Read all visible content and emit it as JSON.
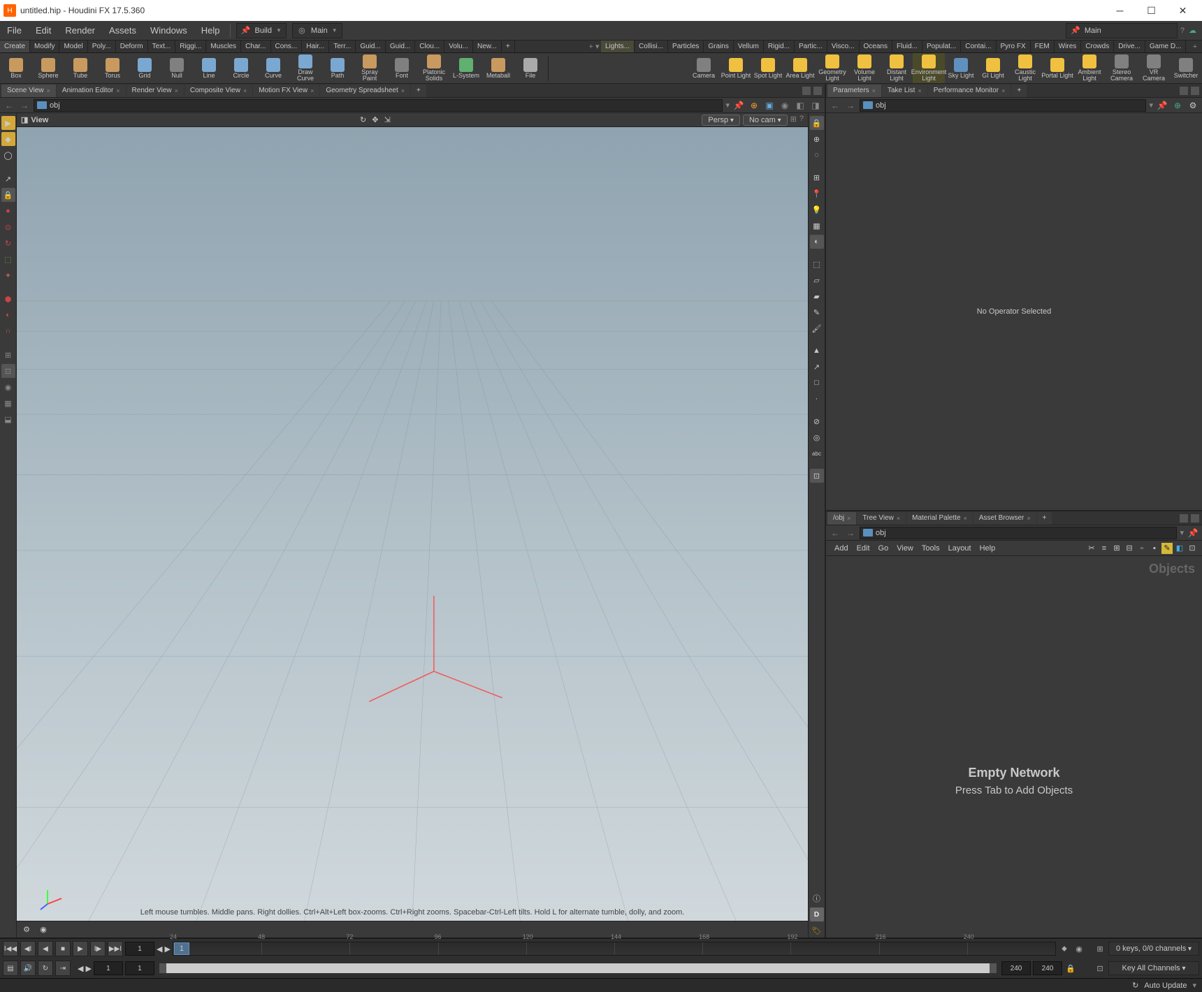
{
  "window": {
    "title": "untitled.hip - Houdini FX 17.5.360"
  },
  "menus": [
    "File",
    "Edit",
    "Render",
    "Assets",
    "Windows",
    "Help"
  ],
  "desktops": {
    "left": "Build",
    "right": "Main",
    "combo": "Main"
  },
  "shelf_tabs_left": [
    "Create",
    "Modify",
    "Model",
    "Poly...",
    "Deform",
    "Text...",
    "Riggi...",
    "Muscles",
    "Char...",
    "Cons...",
    "Hair...",
    "Terr...",
    "Guid...",
    "Guid...",
    "Clou...",
    "Volu...",
    "New...",
    "+"
  ],
  "shelf_tabs_right": [
    "Lights...",
    "Collisi...",
    "Particles",
    "Grains",
    "Vellum",
    "Rigid...",
    "Partic...",
    "Visco...",
    "Oceans",
    "Fluid...",
    "Populat...",
    "Contai...",
    "Pyro FX",
    "FEM",
    "Wires",
    "Crowds",
    "Drive...",
    "Game D...",
    "+"
  ],
  "create_tools": [
    {
      "label": "Box",
      "color": "#c89a60"
    },
    {
      "label": "Sphere",
      "color": "#c89a60"
    },
    {
      "label": "Tube",
      "color": "#c89a60"
    },
    {
      "label": "Torus",
      "color": "#c89a60"
    },
    {
      "label": "Grid",
      "color": "#7aa8d0"
    },
    {
      "label": "Null",
      "color": "#808080"
    },
    {
      "label": "Line",
      "color": "#7aa8d0"
    },
    {
      "label": "Circle",
      "color": "#7aa8d0"
    },
    {
      "label": "Curve",
      "color": "#7aa8d0"
    },
    {
      "label": "Draw Curve",
      "color": "#7aa8d0"
    },
    {
      "label": "Path",
      "color": "#7aa8d0"
    },
    {
      "label": "Spray Paint",
      "color": "#c89a60"
    },
    {
      "label": "Font",
      "color": "#808080"
    },
    {
      "label": "Platonic Solids",
      "color": "#c89a60"
    },
    {
      "label": "L-System",
      "color": "#60b070"
    },
    {
      "label": "Metaball",
      "color": "#c89a60"
    },
    {
      "label": "File",
      "color": "#aaaaaa"
    }
  ],
  "light_tools": [
    {
      "label": "Camera",
      "color": "#808080"
    },
    {
      "label": "Point Light",
      "color": "#f0c040"
    },
    {
      "label": "Spot Light",
      "color": "#f0c040"
    },
    {
      "label": "Area Light",
      "color": "#f0c040"
    },
    {
      "label": "Geometry Light",
      "color": "#f0c040"
    },
    {
      "label": "Volume Light",
      "color": "#f0c040"
    },
    {
      "label": "Distant Light",
      "color": "#f0c040"
    },
    {
      "label": "Environment Light",
      "color": "#f0c040",
      "hl": true
    },
    {
      "label": "Sky Light",
      "color": "#6090c0"
    },
    {
      "label": "GI Light",
      "color": "#f0c040"
    },
    {
      "label": "Caustic Light",
      "color": "#f0c040"
    },
    {
      "label": "Portal Light",
      "color": "#f0c040"
    },
    {
      "label": "Ambient Light",
      "color": "#f0c040"
    },
    {
      "label": "Stereo Camera",
      "color": "#808080"
    },
    {
      "label": "VR Camera",
      "color": "#808080"
    },
    {
      "label": "Switcher",
      "color": "#808080"
    }
  ],
  "left_tabs": [
    "Scene View",
    "Animation Editor",
    "Render View",
    "Composite View",
    "Motion FX View",
    "Geometry Spreadsheet"
  ],
  "right_top_tabs": [
    "Parameters",
    "Take List",
    "Performance Monitor"
  ],
  "right_bot_tabs": [
    "/obj",
    "Tree View",
    "Material Palette",
    "Asset Browser"
  ],
  "path": "obj",
  "viewport": {
    "view_label": "View",
    "persp": "Persp",
    "cam": "No cam",
    "hint": "Left mouse tumbles. Middle pans. Right dollies. Ctrl+Alt+Left box-zooms. Ctrl+Right zooms. Spacebar-Ctrl-Left tilts. Hold L for alternate tumble, dolly, and zoom."
  },
  "params_empty": "No Operator Selected",
  "network_menu": [
    "Add",
    "Edit",
    "Go",
    "View",
    "Tools",
    "Layout",
    "Help"
  ],
  "network": {
    "context": "Objects",
    "empty1": "Empty Network",
    "empty2": "Press Tab to Add Objects"
  },
  "timeline": {
    "start": "1",
    "cur": "1",
    "end": "240",
    "end2": "240",
    "rstart": "1",
    "rcur": "1",
    "ticks": [
      "24",
      "48",
      "72",
      "96",
      "120",
      "144",
      "168",
      "192",
      "216",
      "240"
    ],
    "keys": "0 keys, 0/0 channels",
    "chan": "Key All Channels",
    "update": "Auto Update"
  }
}
